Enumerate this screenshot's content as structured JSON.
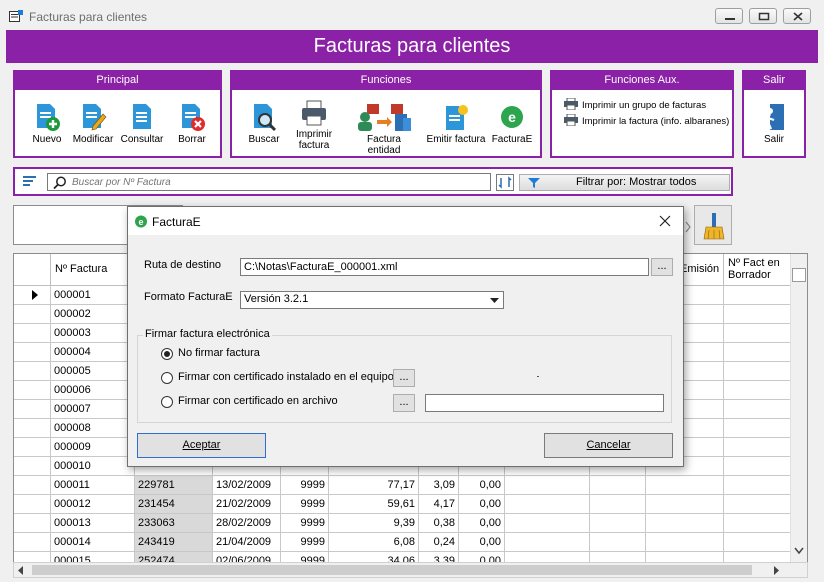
{
  "window": {
    "title": "Facturas para clientes"
  },
  "header": {
    "title": "Facturas para clientes"
  },
  "groups": {
    "principal": {
      "title": "Principal",
      "buttons": [
        "Nuevo",
        "Modificar",
        "Consultar",
        "Borrar"
      ]
    },
    "funciones": {
      "title": "Funciones",
      "buttons": [
        "Buscar",
        "Imprimir factura",
        "Factura entidad",
        "Emitir factura",
        "FacturaE"
      ]
    },
    "aux": {
      "title": "Funciones Aux.",
      "items": [
        "Imprimir un grupo de facturas",
        "Imprimir la factura (info. albaranes)"
      ]
    },
    "salir": {
      "title": "Salir",
      "button": "Salir"
    }
  },
  "search": {
    "placeholder": "Buscar por Nº Factura",
    "filter_label": "Filtrar por: Mostrar todos"
  },
  "grid": {
    "headers": {
      "numero": "Nº Factura",
      "emision": "Emisión",
      "borrador": "Nº Fact en Borrador"
    },
    "rows": [
      [
        "000001",
        "",
        "",
        "",
        "",
        "",
        ""
      ],
      [
        "000002",
        "",
        "",
        "",
        "",
        "",
        ""
      ],
      [
        "000003",
        "",
        "",
        "",
        "",
        "",
        ""
      ],
      [
        "000004",
        "",
        "",
        "",
        "",
        "",
        ""
      ],
      [
        "000005",
        "",
        "",
        "",
        "",
        "",
        ""
      ],
      [
        "000006",
        "",
        "",
        "",
        "",
        "",
        ""
      ],
      [
        "000007",
        "",
        "",
        "",
        "",
        "",
        ""
      ],
      [
        "000008",
        "",
        "",
        "",
        "",
        "",
        ""
      ],
      [
        "000009",
        "",
        "",
        "",
        "",
        "",
        ""
      ],
      [
        "000010",
        "",
        "",
        "",
        "",
        "",
        ""
      ],
      [
        "000011",
        "229781",
        "13/02/2009",
        "9999",
        "77,17",
        "3,09",
        "0,00"
      ],
      [
        "000012",
        "231454",
        "21/02/2009",
        "9999",
        "59,61",
        "4,17",
        "0,00"
      ],
      [
        "000013",
        "233063",
        "28/02/2009",
        "9999",
        "9,39",
        "0,38",
        "0,00"
      ],
      [
        "000014",
        "243419",
        "21/04/2009",
        "9999",
        "6,08",
        "0,24",
        "0,00"
      ],
      [
        "000015",
        "252474",
        "02/06/2009",
        "9999",
        "34,06",
        "3,39",
        "0,00"
      ]
    ]
  },
  "dialog": {
    "title": "FacturaE",
    "ruta_label": "Ruta de destino",
    "ruta_value": "C:\\Notas\\FacturaE_000001.xml",
    "browse_label": "...",
    "formato_label": "Formato FacturaE",
    "formato_value": "Versión 3.2.1",
    "firmar_legend": "Firmar factura electrónica",
    "options": [
      "No firmar factura",
      "Firmar con certificado instalado en el equipo",
      "Firmar con certificado en archivo"
    ],
    "selected_option": 0,
    "accept_label": "Aceptar",
    "cancel_label": "Cancelar"
  },
  "colors": {
    "accent": "#8a21a6"
  }
}
